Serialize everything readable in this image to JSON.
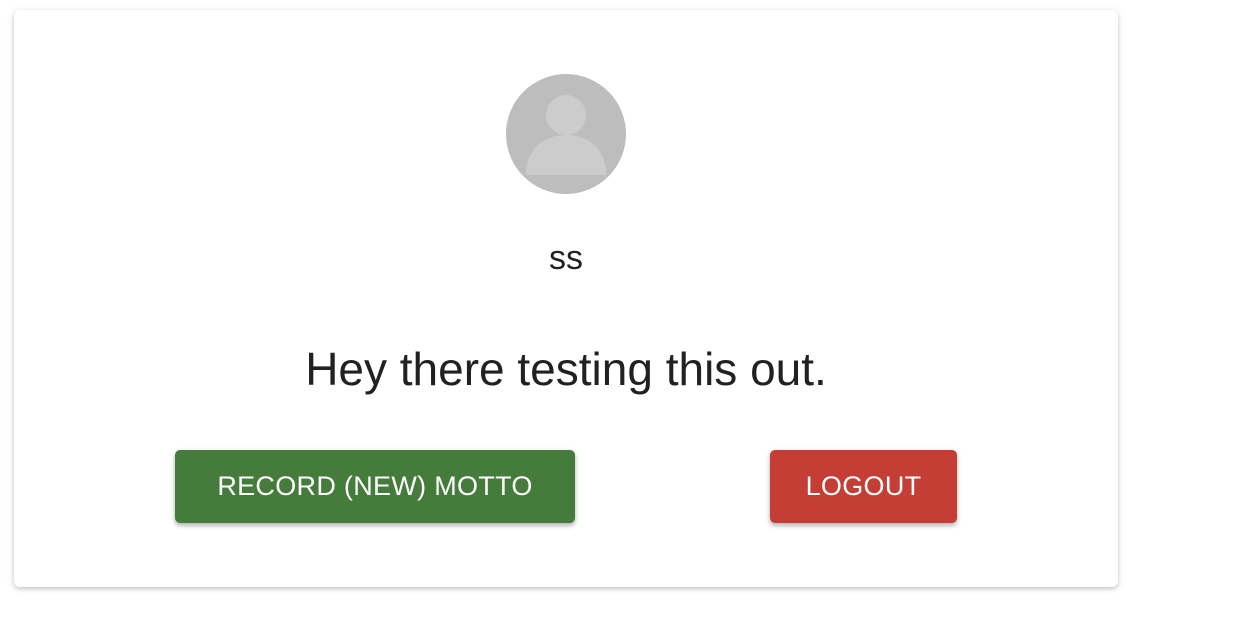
{
  "profile": {
    "avatar_icon": "person-placeholder-icon",
    "username": "ss",
    "motto": "Hey there testing this out."
  },
  "actions": {
    "record_label": "RECORD (NEW) MOTTO",
    "logout_label": "LOGOUT"
  },
  "colors": {
    "record_button": "#457b3b",
    "logout_button": "#c53e36",
    "avatar_bg": "#bdbdbd",
    "avatar_figure": "#cccccc"
  }
}
